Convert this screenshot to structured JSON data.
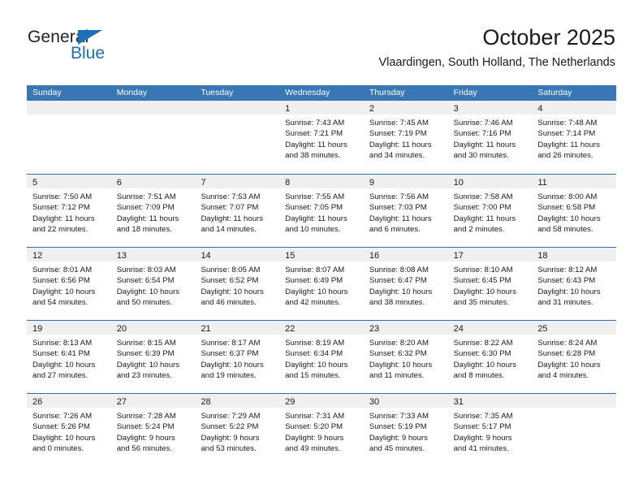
{
  "brand": {
    "name_top": "General",
    "name_bottom": "Blue",
    "accent_color": "#1b70b8"
  },
  "header": {
    "title": "October 2025",
    "subtitle": "Vlaardingen, South Holland, The Netherlands"
  },
  "theme": {
    "header_bar_color": "#3876b4",
    "week_divider_color": "#2f6fae",
    "date_band_color": "#f0f0f0",
    "text_color": "#1a1a1a"
  },
  "weekdays": [
    "Sunday",
    "Monday",
    "Tuesday",
    "Wednesday",
    "Thursday",
    "Friday",
    "Saturday"
  ],
  "weeks": [
    [
      {
        "day": "",
        "lines": []
      },
      {
        "day": "",
        "lines": []
      },
      {
        "day": "",
        "lines": []
      },
      {
        "day": "1",
        "lines": [
          "Sunrise: 7:43 AM",
          "Sunset: 7:21 PM",
          "Daylight: 11 hours",
          "and 38 minutes."
        ]
      },
      {
        "day": "2",
        "lines": [
          "Sunrise: 7:45 AM",
          "Sunset: 7:19 PM",
          "Daylight: 11 hours",
          "and 34 minutes."
        ]
      },
      {
        "day": "3",
        "lines": [
          "Sunrise: 7:46 AM",
          "Sunset: 7:16 PM",
          "Daylight: 11 hours",
          "and 30 minutes."
        ]
      },
      {
        "day": "4",
        "lines": [
          "Sunrise: 7:48 AM",
          "Sunset: 7:14 PM",
          "Daylight: 11 hours",
          "and 26 minutes."
        ]
      }
    ],
    [
      {
        "day": "5",
        "lines": [
          "Sunrise: 7:50 AM",
          "Sunset: 7:12 PM",
          "Daylight: 11 hours",
          "and 22 minutes."
        ]
      },
      {
        "day": "6",
        "lines": [
          "Sunrise: 7:51 AM",
          "Sunset: 7:09 PM",
          "Daylight: 11 hours",
          "and 18 minutes."
        ]
      },
      {
        "day": "7",
        "lines": [
          "Sunrise: 7:53 AM",
          "Sunset: 7:07 PM",
          "Daylight: 11 hours",
          "and 14 minutes."
        ]
      },
      {
        "day": "8",
        "lines": [
          "Sunrise: 7:55 AM",
          "Sunset: 7:05 PM",
          "Daylight: 11 hours",
          "and 10 minutes."
        ]
      },
      {
        "day": "9",
        "lines": [
          "Sunrise: 7:56 AM",
          "Sunset: 7:03 PM",
          "Daylight: 11 hours",
          "and 6 minutes."
        ]
      },
      {
        "day": "10",
        "lines": [
          "Sunrise: 7:58 AM",
          "Sunset: 7:00 PM",
          "Daylight: 11 hours",
          "and 2 minutes."
        ]
      },
      {
        "day": "11",
        "lines": [
          "Sunrise: 8:00 AM",
          "Sunset: 6:58 PM",
          "Daylight: 10 hours",
          "and 58 minutes."
        ]
      }
    ],
    [
      {
        "day": "12",
        "lines": [
          "Sunrise: 8:01 AM",
          "Sunset: 6:56 PM",
          "Daylight: 10 hours",
          "and 54 minutes."
        ]
      },
      {
        "day": "13",
        "lines": [
          "Sunrise: 8:03 AM",
          "Sunset: 6:54 PM",
          "Daylight: 10 hours",
          "and 50 minutes."
        ]
      },
      {
        "day": "14",
        "lines": [
          "Sunrise: 8:05 AM",
          "Sunset: 6:52 PM",
          "Daylight: 10 hours",
          "and 46 minutes."
        ]
      },
      {
        "day": "15",
        "lines": [
          "Sunrise: 8:07 AM",
          "Sunset: 6:49 PM",
          "Daylight: 10 hours",
          "and 42 minutes."
        ]
      },
      {
        "day": "16",
        "lines": [
          "Sunrise: 8:08 AM",
          "Sunset: 6:47 PM",
          "Daylight: 10 hours",
          "and 38 minutes."
        ]
      },
      {
        "day": "17",
        "lines": [
          "Sunrise: 8:10 AM",
          "Sunset: 6:45 PM",
          "Daylight: 10 hours",
          "and 35 minutes."
        ]
      },
      {
        "day": "18",
        "lines": [
          "Sunrise: 8:12 AM",
          "Sunset: 6:43 PM",
          "Daylight: 10 hours",
          "and 31 minutes."
        ]
      }
    ],
    [
      {
        "day": "19",
        "lines": [
          "Sunrise: 8:13 AM",
          "Sunset: 6:41 PM",
          "Daylight: 10 hours",
          "and 27 minutes."
        ]
      },
      {
        "day": "20",
        "lines": [
          "Sunrise: 8:15 AM",
          "Sunset: 6:39 PM",
          "Daylight: 10 hours",
          "and 23 minutes."
        ]
      },
      {
        "day": "21",
        "lines": [
          "Sunrise: 8:17 AM",
          "Sunset: 6:37 PM",
          "Daylight: 10 hours",
          "and 19 minutes."
        ]
      },
      {
        "day": "22",
        "lines": [
          "Sunrise: 8:19 AM",
          "Sunset: 6:34 PM",
          "Daylight: 10 hours",
          "and 15 minutes."
        ]
      },
      {
        "day": "23",
        "lines": [
          "Sunrise: 8:20 AM",
          "Sunset: 6:32 PM",
          "Daylight: 10 hours",
          "and 11 minutes."
        ]
      },
      {
        "day": "24",
        "lines": [
          "Sunrise: 8:22 AM",
          "Sunset: 6:30 PM",
          "Daylight: 10 hours",
          "and 8 minutes."
        ]
      },
      {
        "day": "25",
        "lines": [
          "Sunrise: 8:24 AM",
          "Sunset: 6:28 PM",
          "Daylight: 10 hours",
          "and 4 minutes."
        ]
      }
    ],
    [
      {
        "day": "26",
        "lines": [
          "Sunrise: 7:26 AM",
          "Sunset: 5:26 PM",
          "Daylight: 10 hours",
          "and 0 minutes."
        ]
      },
      {
        "day": "27",
        "lines": [
          "Sunrise: 7:28 AM",
          "Sunset: 5:24 PM",
          "Daylight: 9 hours",
          "and 56 minutes."
        ]
      },
      {
        "day": "28",
        "lines": [
          "Sunrise: 7:29 AM",
          "Sunset: 5:22 PM",
          "Daylight: 9 hours",
          "and 53 minutes."
        ]
      },
      {
        "day": "29",
        "lines": [
          "Sunrise: 7:31 AM",
          "Sunset: 5:20 PM",
          "Daylight: 9 hours",
          "and 49 minutes."
        ]
      },
      {
        "day": "30",
        "lines": [
          "Sunrise: 7:33 AM",
          "Sunset: 5:19 PM",
          "Daylight: 9 hours",
          "and 45 minutes."
        ]
      },
      {
        "day": "31",
        "lines": [
          "Sunrise: 7:35 AM",
          "Sunset: 5:17 PM",
          "Daylight: 9 hours",
          "and 41 minutes."
        ]
      },
      {
        "day": "",
        "lines": []
      }
    ]
  ]
}
